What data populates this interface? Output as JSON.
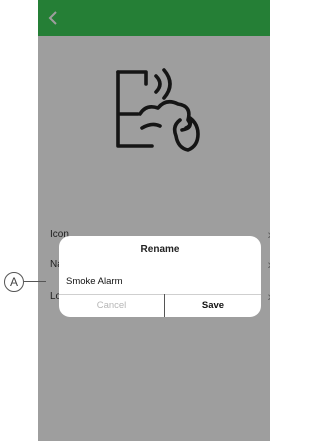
{
  "header": {
    "back_icon": "chevron-left-icon",
    "color": "#3dcd58"
  },
  "device": {
    "icon": "smoke-fire-alarm-icon"
  },
  "settings": {
    "rows": [
      {
        "label": "Icon"
      },
      {
        "label": "Name"
      },
      {
        "label": "Location"
      }
    ]
  },
  "dialog": {
    "title": "Rename",
    "name_value": "Smoke Alarm",
    "cancel_label": "Cancel",
    "save_label": "Save"
  },
  "callout": {
    "label": "A"
  }
}
